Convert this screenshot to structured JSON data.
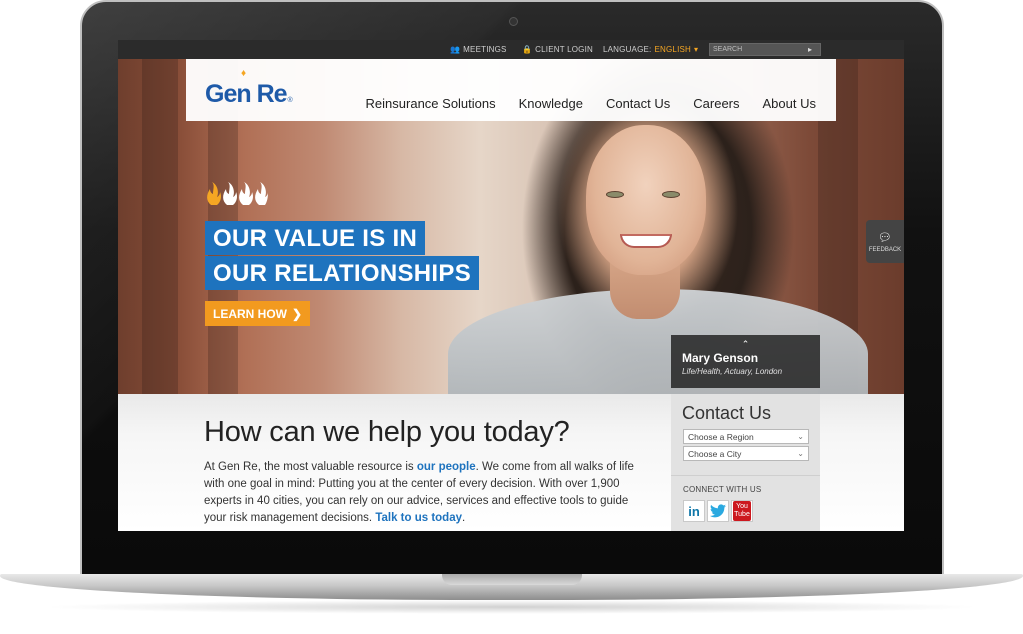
{
  "utility": {
    "meetings": "MEETINGS",
    "client_login": "CLIENT LOGIN",
    "language_label": "LANGUAGE:",
    "language_value": "ENGLISH",
    "search_placeholder": "SEARCH"
  },
  "brand": {
    "logo_text": "Gen Re",
    "logo_mark": "®"
  },
  "nav": {
    "items": [
      {
        "label": "Reinsurance Solutions"
      },
      {
        "label": "Knowledge"
      },
      {
        "label": "Contact Us"
      },
      {
        "label": "Careers"
      },
      {
        "label": "About Us"
      }
    ]
  },
  "hero": {
    "headline_line1": "OUR VALUE IS IN",
    "headline_line2": "OUR RELATIONSHIPS",
    "cta_label": "LEARN HOW",
    "cta_chevron": "❯",
    "caption_chevron": "⌃",
    "caption_name": "Mary Genson",
    "caption_title": "Life/Health, Actuary, London",
    "feedback_label": "FEEDBACK"
  },
  "content": {
    "title": "How can we help you today?",
    "body_1": "At Gen Re, the most valuable resource is ",
    "link_people": "our people",
    "body_2": ". We come from all walks of life with one goal in mind:  Putting you at the center of every decision. With over 1,900 experts in 40 cities, you can rely on our advice, services and effective tools to guide your risk management decisions. ",
    "link_talk": "Talk to us today",
    "body_3": "."
  },
  "sidebar": {
    "contact_title": "Contact Us",
    "region_select": "Choose a Region",
    "city_select": "Choose a City",
    "connect_title": "CONNECT WITH US",
    "social": {
      "linkedin": "in",
      "youtube_top": "You",
      "youtube_bottom": "Tube"
    }
  },
  "colors": {
    "brand_blue": "#1e73be",
    "accent_orange": "#f29a1f",
    "utility_bar": "#2b2b2b"
  }
}
